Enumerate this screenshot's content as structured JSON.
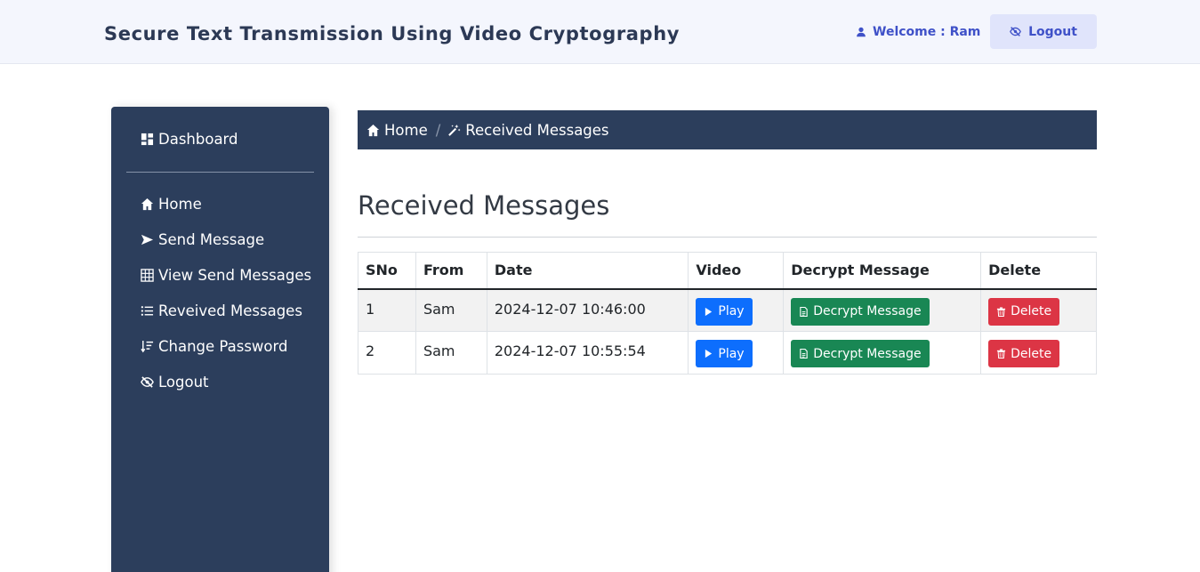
{
  "header": {
    "title": "Secure Text Transmission Using Video Cryptography",
    "welcome_text": "Welcome : Ram",
    "logout_label": "Logout"
  },
  "sidebar": {
    "items": [
      {
        "label": "Dashboard",
        "icon": "dashboard-icon"
      },
      {
        "label": "Home",
        "icon": "home-icon"
      },
      {
        "label": "Send Message",
        "icon": "send-icon"
      },
      {
        "label": "View Send Messages",
        "icon": "grid-icon"
      },
      {
        "label": "Reveived Messages",
        "icon": "list-icon"
      },
      {
        "label": "Change Password",
        "icon": "sort-icon"
      },
      {
        "label": "Logout",
        "icon": "eye-slash-icon"
      }
    ]
  },
  "breadcrumb": {
    "home": "Home",
    "current": "Received Messages",
    "separator": "/"
  },
  "page": {
    "title": "Received Messages"
  },
  "table": {
    "headers": [
      "SNo",
      "From",
      "Date",
      "Video",
      "Decrypt Message",
      "Delete"
    ],
    "rows": [
      {
        "sno": "1",
        "from": "Sam",
        "date": "2024-12-07 10:46:00"
      },
      {
        "sno": "2",
        "from": "Sam",
        "date": "2024-12-07 10:55:54"
      }
    ],
    "play_label": "Play",
    "decrypt_label": "Decrypt Message",
    "delete_label": "Delete"
  },
  "colors": {
    "navy": "#2c3e5c",
    "header_bg": "#f4f6fd",
    "accent": "#3f51c8",
    "play": "#0d6efd",
    "decrypt": "#198754",
    "delete": "#dc3545"
  }
}
